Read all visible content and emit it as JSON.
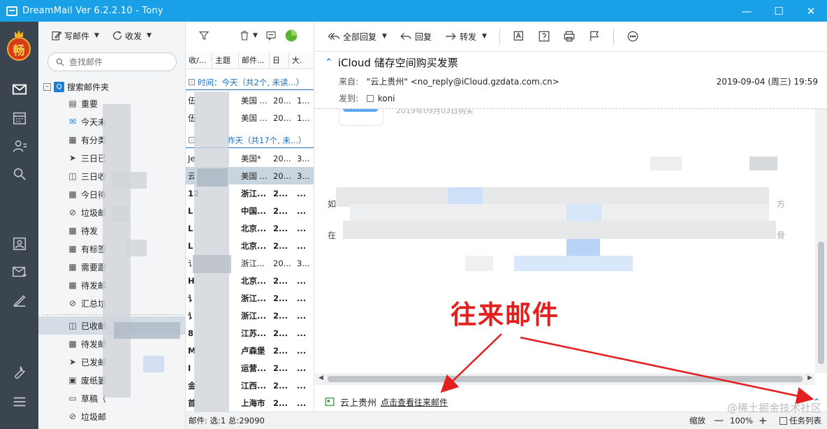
{
  "window": {
    "title": "DreamMail Ver 6.2.2.10  -  Tony"
  },
  "rail": {
    "avatar_char": "畅"
  },
  "folders_toolbar": {
    "compose_label": "写邮件",
    "sendrecv_label": "收发"
  },
  "search": {
    "placeholder": "查找邮件"
  },
  "tree": {
    "root_label": "搜索邮件夹",
    "items": [
      {
        "label": "重要",
        "icon": "doc-icon"
      },
      {
        "label": "今天未",
        "icon": "mail-blue-icon"
      },
      {
        "label": "有分类",
        "icon": "grid-icon"
      },
      {
        "label": "三日已",
        "icon": "send-icon"
      },
      {
        "label": "三日收",
        "icon": "inbox-icon"
      },
      {
        "label": "今日待",
        "icon": "tray-icon"
      },
      {
        "label": "垃圾邮",
        "icon": "block-icon"
      },
      {
        "label": "待发",
        "icon": "tray-icon"
      },
      {
        "label": "有标签",
        "icon": "grid-icon"
      },
      {
        "label": "需要跟",
        "icon": "grid-icon"
      },
      {
        "label": "待发邮",
        "icon": "tray-icon"
      },
      {
        "label": "汇总垃",
        "icon": "block-icon"
      }
    ],
    "account_items": [
      {
        "label": "已收邮",
        "icon": "inbox-icon"
      },
      {
        "label": "待发邮",
        "icon": "tray-icon"
      },
      {
        "label": "已发邮",
        "icon": "send-icon"
      },
      {
        "label": "废纸篓",
        "icon": "trash-icon"
      },
      {
        "label": "草稿（",
        "icon": "draft-icon"
      },
      {
        "label": "垃圾邮",
        "icon": "block-icon"
      }
    ]
  },
  "list": {
    "columns": [
      "收/...",
      "主题",
      "邮件...",
      "日",
      "大."
    ],
    "group_today": "时间：今天（共2个, 未读...）",
    "group_yesterday": "昨天（共17个, 未...）",
    "rows_today": [
      {
        "c1": "伍",
        "c2": "美国 ...",
        "c3": "20...",
        "c4": "1..."
      },
      {
        "c1": "伍",
        "c2": "美国 ...",
        "c3": "20...",
        "c4": "1..."
      }
    ],
    "rows_yesterday": [
      {
        "c1": "Je",
        "c2": "美国*",
        "c3": "20...",
        "c4": "3...",
        "bold": false,
        "sel": false
      },
      {
        "c1": "云",
        "c2": "美国 ...",
        "c3": "20...",
        "c4": "3...",
        "bold": false,
        "sel": true
      },
      {
        "c1": "12",
        "c2": "浙江...",
        "c3": "2...",
        "c4": "...",
        "bold": true,
        "sel": false
      },
      {
        "c1": "L",
        "c2": "中国...",
        "c3": "2...",
        "c4": "...",
        "bold": true,
        "sel": false
      },
      {
        "c1": "L",
        "c2": "北京...",
        "c3": "2...",
        "c4": "...",
        "bold": true,
        "sel": false
      },
      {
        "c1": "L",
        "c2": "北京...",
        "c3": "2...",
        "c4": "...",
        "bold": true,
        "sel": false
      },
      {
        "c1": "讠",
        "c2": "浙江...",
        "c3": "20...",
        "c4": "3...",
        "bold": false,
        "sel": false
      },
      {
        "c1": "H",
        "c2": "北京...",
        "c3": "2...",
        "c4": "...",
        "bold": true,
        "sel": false
      },
      {
        "c1": "讠",
        "c2": "浙江...",
        "c3": "2...",
        "c4": "...",
        "bold": true,
        "sel": false
      },
      {
        "c1": "讠",
        "c2": "浙江...",
        "c3": "2...",
        "c4": "...",
        "bold": true,
        "sel": false
      },
      {
        "c1": "8",
        "c2": "江苏...",
        "c3": "2...",
        "c4": "...",
        "bold": true,
        "sel": false
      },
      {
        "c1": "M",
        "c2": "卢森堡",
        "c3": "2...",
        "c4": "...",
        "bold": true,
        "sel": false
      },
      {
        "c1": "I",
        "c2": "运营...",
        "c3": "2...",
        "c4": "...",
        "bold": true,
        "sel": false
      },
      {
        "c1": "金",
        "c2": "江西...",
        "c3": "2...",
        "c4": "...",
        "bold": true,
        "sel": false
      },
      {
        "c1": "首",
        "c2": "上海市",
        "c3": "2...",
        "c4": "...",
        "bold": true,
        "sel": false
      }
    ]
  },
  "reader": {
    "toolbar": {
      "reply_all": "全部回复",
      "reply": "回复",
      "forward": "转发"
    },
    "subject": "iCloud 储存空间购买发票",
    "from_label": "来自:",
    "from_value": "\"云上贵州\" <no_reply@iCloud.gzdata.com.cn>",
    "to_label": "发到:",
    "to_value": "koni",
    "date": "2019-09-04 (周三) 19:59",
    "body_snippet": "2019年09月03日购买",
    "body_line1_first": "如",
    "body_line1_last": "方",
    "body_line2_first": "在",
    "body_line2_last": "骨",
    "footer_sender": "云上贵州",
    "footer_link": "点击查看往来邮件"
  },
  "annotation": {
    "text": "往来邮件"
  },
  "status": {
    "left": "邮件: 选:1 总:29090",
    "zoom_label": "缩放",
    "zoom_value": "100%",
    "tasklist": "任务列表"
  },
  "watermark": "@稀土掘金技术社区",
  "colors": {
    "titlebar": "#1aa0e6",
    "rail": "#3a4550",
    "accent": "#1a80d6",
    "annotation": "#e1201f"
  }
}
